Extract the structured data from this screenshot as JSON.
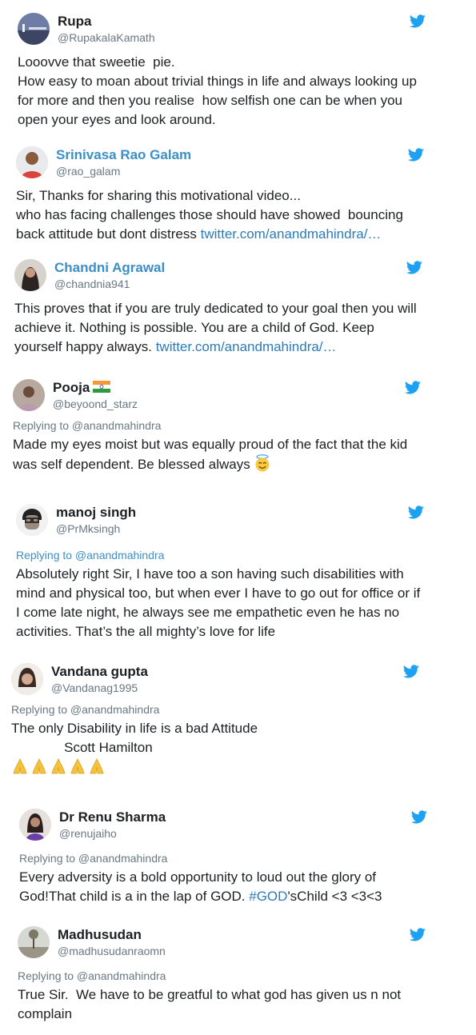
{
  "tweets": [
    {
      "name": "Rupa",
      "handle": "@RupakalaKamath",
      "text": "Looovve that sweetie  pie.\nHow easy to moan about trivial things in life and always looking up for more and then you realise  how selfish one can be when you open your eyes and look around."
    },
    {
      "name": "Srinivasa Rao Galam",
      "handle": "@rao_galam",
      "text": "Sir, Thanks for sharing this motivational video...\nwho has facing challenges those should have showed  bouncing back attitude but dont distress ",
      "link": "twitter.com/anandmahindra/…"
    },
    {
      "name": "Chandni Agrawal",
      "handle": "@chandnia941",
      "text": "This proves that if you are truly dedicated to your goal then you will achieve it. Nothing is possible. You are a child of God. Keep yourself happy always. ",
      "link": "twitter.com/anandmahindra/…"
    },
    {
      "name": "Pooja",
      "handle": "@beyoond_starz",
      "reply": "Replying to @anandmahindra",
      "text": "Made my eyes moist but was equally proud of the fact that the kid was self dependent. Be blessed always "
    },
    {
      "name": "manoj singh",
      "handle": "@PrMksingh",
      "reply": "Replying to @anandmahindra",
      "text": "Absolutely right Sir, I have too a son having such disabilities with mind and physical too, but when ever I have to go out for office or if I come late night, he always see me empathetic even he has no activities. That’s the all mighty’s love for life"
    },
    {
      "name": "Vandana gupta",
      "handle": "@Vandanag1995",
      "reply": "Replying to @anandmahindra",
      "text": "The only Disability in life is a bad Attitude\n              Scott Hamilton"
    },
    {
      "name": "Dr Renu Sharma",
      "handle": "@renujaiho",
      "reply": "Replying to @anandmahindra",
      "text_before": "Every adversity is a bold opportunity to loud out the glory of God!That child is a in the lap of GOD. ",
      "hashtag": "#GOD",
      "text_after": "'sChild <3 <3<3"
    },
    {
      "name": "Madhusudan",
      "handle": "@madhusudanraomn",
      "reply": "Replying to @anandmahindra",
      "text": "True Sir.  We have to be greatful to what god has given us n not complain"
    }
  ],
  "icons": {
    "bird": "twitter-bird-icon",
    "flag": "india-flag-icon",
    "halo": "smiling-face-with-halo-icon",
    "pray": "folded-hands-icon"
  },
  "colors": {
    "bird": "#1da1f2",
    "link": "#2b7bb9",
    "name_blue": "#3b8fc8",
    "muted": "#697882"
  }
}
